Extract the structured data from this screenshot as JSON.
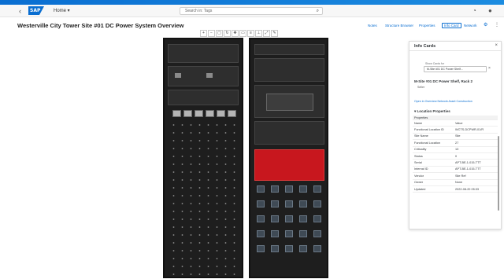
{
  "shell": {
    "home_label": "Home",
    "search_placeholder": "Search in: Tags"
  },
  "page": {
    "title": "Westerville City Tower Site #01 DC Power System Overview",
    "toolbar": [
      "Notes",
      "Structure Browser",
      "Properties",
      "Info Card",
      "Network"
    ]
  },
  "info_card": {
    "title": "Info Cards",
    "select_label": "Show Cards for",
    "select_value": "M-Site #01 DC Power Shelf...",
    "asset_title": "M-Site #01 DC Power Shelf, Rack 2",
    "asset_sub": "Seller",
    "link_text": "Open in Overview Network Asset Construction",
    "section_title": "Location Properties",
    "prop_header": "Properties",
    "props": [
      {
        "k": "Name",
        "v": "Value"
      },
      {
        "k": "Functional Location ID",
        "v": "WCTS-DCPWR-01/R"
      },
      {
        "k": "Site Name",
        "v": "Site"
      },
      {
        "k": "Functional Location",
        "v": "27"
      },
      {
        "k": "Criticality",
        "v": "13"
      },
      {
        "k": "Status",
        "v": "0"
      },
      {
        "k": "Serial",
        "v": "APT-BE-1-015-TTT"
      },
      {
        "k": "Internal ID",
        "v": "APT-BE-1-015-TTT"
      },
      {
        "k": "Vendor",
        "v": "Site Ref"
      },
      {
        "k": "Owner",
        "v": "None"
      },
      {
        "k": "Updated",
        "v": "2022-08-20 05:33"
      }
    ]
  }
}
